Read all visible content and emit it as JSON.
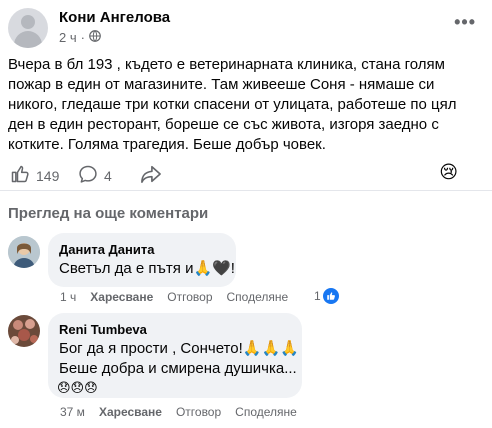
{
  "post": {
    "author": "Кони Ангелова",
    "time": "2 ч",
    "text": "Вчера в бл 193 , където е ветеринарната клиника, стана голям пожар в един от магазините. Там живееше Соня - нямаше си никого, гледаше три котки спасени от улицата, работеше по цял ден в един ресторант, бореше се със живота, изгоря заедно с котките. Голяма трагедия. Беше добър човек.",
    "like_count": "149",
    "comment_count": "4",
    "reaction_emoji": "😢"
  },
  "more_comments_label": "Преглед на още коментари",
  "comments": [
    {
      "name": "Данита Данита",
      "text": "Светъл да е пътя и🙏🖤!",
      "time": "1 ч",
      "like_label": "Харесване",
      "reply_label": "Отговор",
      "share_label": "Споделяне",
      "reaction_count": "1"
    },
    {
      "name": "Reni Tumbeva",
      "line1": "Бог да я прости , Сончето!🙏🙏🙏",
      "line2": "Беше добра и смирена душичка...",
      "line3": "😞😞😞",
      "time": "37 м",
      "like_label": "Харесване",
      "reply_label": "Отговор",
      "share_label": "Споделяне"
    }
  ],
  "icons": {
    "more": "more-horizontal-icon",
    "globe": "globe-icon",
    "like": "thumbs-up-icon",
    "comment": "comment-icon",
    "share": "share-icon"
  },
  "colors": {
    "like_blue": "#1877f2",
    "secondary_text": "#65676b",
    "bubble_bg": "#f0f2f5"
  }
}
